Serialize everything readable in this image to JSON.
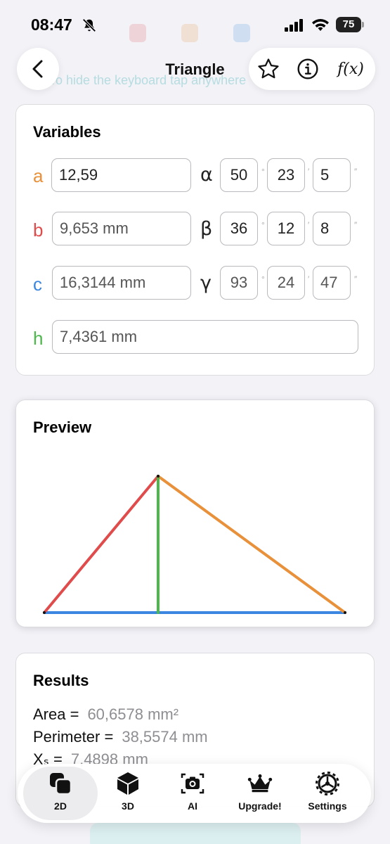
{
  "status_bar": {
    "time": "08:47",
    "battery": "75"
  },
  "header": {
    "title": "Triangle",
    "fx_label": "f(x)"
  },
  "background_hint": "To hide the keyboard tap anywhere",
  "variables": {
    "title": "Variables",
    "sides": [
      {
        "letter": "a",
        "value": "12,59",
        "color": "#e8913a"
      },
      {
        "letter": "b",
        "value": "9,653 mm",
        "color": "#e04b4b"
      },
      {
        "letter": "c",
        "value": "16,3144 mm",
        "color": "#3a86e0"
      },
      {
        "letter": "h",
        "value": "7,4361 mm",
        "color": "#4cb84c"
      }
    ],
    "angles": [
      {
        "symbol": "α",
        "deg": "50",
        "min": "23",
        "sec": "5"
      },
      {
        "symbol": "β",
        "deg": "36",
        "min": "12",
        "sec": "8"
      },
      {
        "symbol": "γ",
        "deg": "93",
        "min": "24",
        "sec": "47"
      }
    ],
    "deg_mark": "°",
    "min_mark": "′",
    "sec_mark": "″"
  },
  "preview": {
    "title": "Preview"
  },
  "results": {
    "title": "Results",
    "lines": [
      {
        "label": "Area =",
        "value": "60,6578 mm²"
      },
      {
        "label": "Perimeter =",
        "value": "38,5574 mm"
      },
      {
        "label": "Xₛ =",
        "value": "7,4898 mm"
      }
    ]
  },
  "tabbar": {
    "tabs": [
      {
        "label": "2D",
        "icon": "2d-shapes-icon",
        "active": true
      },
      {
        "label": "3D",
        "icon": "cube-icon",
        "active": false
      },
      {
        "label": "AI",
        "icon": "camera-icon",
        "active": false
      },
      {
        "label": "Upgrade!",
        "icon": "crown-icon",
        "active": false
      },
      {
        "label": "Settings",
        "icon": "gear-icon",
        "active": false
      }
    ]
  },
  "colors": {
    "side_a": "#e8913a",
    "side_b": "#e04b4b",
    "side_c": "#3a86e0",
    "height": "#4cb84c"
  }
}
